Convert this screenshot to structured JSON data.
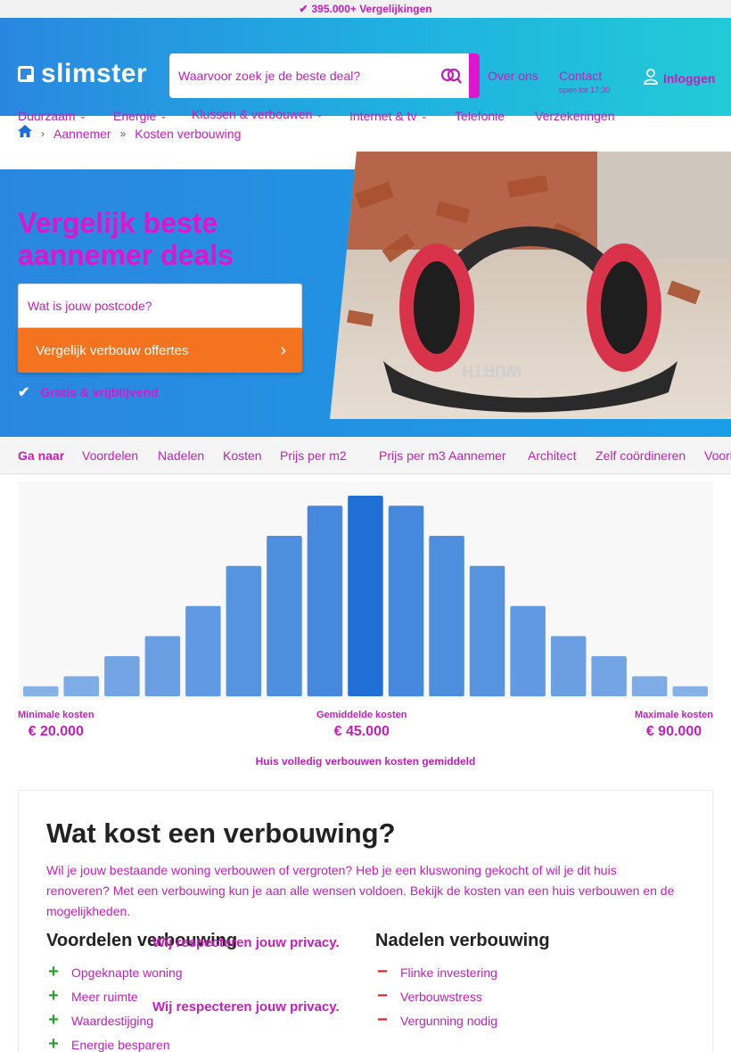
{
  "topbar": {
    "text": "395.000+ Vergelijkingen"
  },
  "header": {
    "logo": "slimster",
    "search_placeholder": "Waarvoor zoek je de beste deal?",
    "over_ons": "Over ons",
    "contact": "Contact",
    "contact_hours": "open tot 17:30",
    "login": "Inloggen"
  },
  "nav": {
    "items": [
      {
        "label": "Duurzaam",
        "has_menu": true
      },
      {
        "label": "Energie",
        "has_menu": true
      },
      {
        "label": "Klussen & verbouwen",
        "has_menu": true
      },
      {
        "label": "Internet & tv",
        "has_menu": true
      },
      {
        "label": "Telefonie",
        "has_menu": false
      },
      {
        "label": "Verzekeringen",
        "has_menu": false
      }
    ]
  },
  "breadcrumb": {
    "items": [
      "Aannemer",
      "Kosten verbouwing"
    ]
  },
  "hero": {
    "title": "Vergelijk beste aannemer deals",
    "postcode_placeholder": "Wat is jouw postcode?",
    "cta": "Vergelijk verbouw offertes",
    "gratis": "Gratis & vrijblijvend"
  },
  "ganaar": {
    "label": "Ga naar",
    "links": [
      "Voordelen",
      "Nadelen",
      "Kosten",
      "Prijs per m2",
      "Prijs per m3",
      "Aannemer",
      "Architect",
      "Zelf coördineren",
      "Voorbeeld"
    ]
  },
  "chart_data": {
    "type": "bar",
    "values": [
      1,
      2,
      4,
      6,
      9,
      13,
      16,
      19,
      20,
      19,
      16,
      13,
      9,
      6,
      4,
      2,
      1
    ],
    "highlight_index": 8,
    "colors": {
      "bar": "#3b82dc",
      "highlight": "#1f6fd6"
    },
    "min_label": "Minimale kosten",
    "min_value": "€ 20.000",
    "avg_label": "Gemiddelde kosten",
    "avg_value": "€ 45.000",
    "max_label": "Maximale kosten",
    "max_value": "€ 90.000",
    "caption": "Huis volledig verbouwen kosten gemiddeld"
  },
  "article": {
    "title": "Wat kost een verbouwing?",
    "intro": "Wil je jouw bestaande woning verbouwen of vergroten? Heb je een kluswoning gekocht of wil je dit huis renoveren? Met een verbouwing kun je aan alle wensen voldoen. Bekijk de kosten van een huis verbouwen en de mogelijkheden.",
    "pros_title": "Voordelen verbouwing",
    "cons_title": "Nadelen verbouwing",
    "privacy": "Wij respecteren jouw privacy.",
    "pros": [
      "Opgeknapte woning",
      "Meer ruimte",
      "Waardestijging",
      "Energie besparen"
    ],
    "cons": [
      "Flinke investering",
      "Verbouwstress",
      "Vergunning nodig"
    ]
  },
  "colors": {
    "brand_gradient_start": "#2a87e0",
    "brand_gradient_end": "#22cad7",
    "cta": "#f4731f",
    "text_highlight": "#c21fb8"
  }
}
